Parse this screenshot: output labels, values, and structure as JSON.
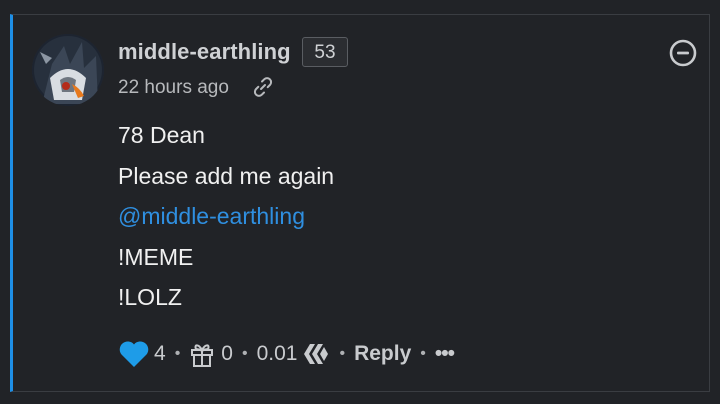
{
  "comment": {
    "author": "middle-earthling",
    "reputation": "53",
    "timestamp": "22 hours ago",
    "lines": [
      "78 Dean",
      "Please add me again",
      "@middle-earthling",
      "!MEME",
      "!LOLZ"
    ],
    "footer": {
      "votes": "4",
      "tips": "0",
      "payout": "0.01",
      "reply_label": "Reply",
      "more_label": "•••"
    }
  },
  "colors": {
    "accent": "#1e8fe6",
    "heart": "#1e9ce8",
    "mention": "#2f8fe0",
    "background": "#212327"
  },
  "icons": {
    "permalink": "link-icon",
    "collapse": "minus-circle-icon",
    "upvote": "heart-icon",
    "tip": "gift-icon",
    "currency": "hive-icon"
  }
}
